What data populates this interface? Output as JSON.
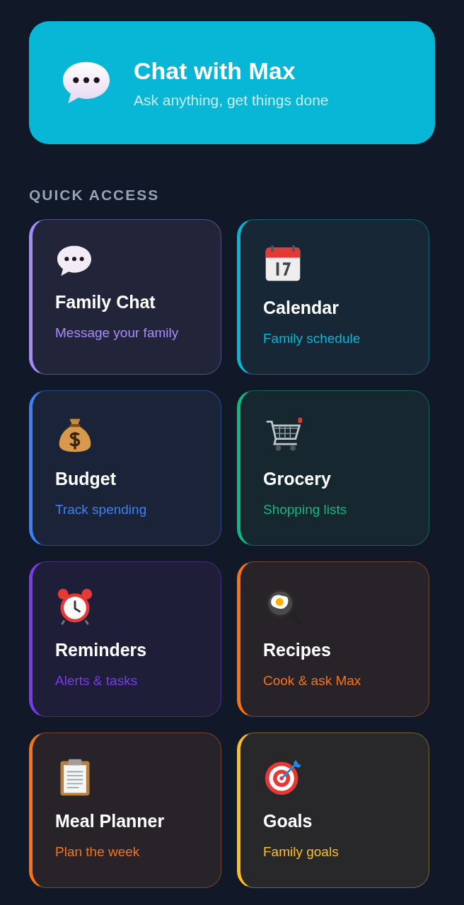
{
  "banner": {
    "title": "Chat with Max",
    "subtitle": "Ask anything, get things done"
  },
  "section_title": "QUICK ACCESS",
  "cards": [
    {
      "title": "Family Chat",
      "subtitle": "Message your family",
      "color": "#a78bfa"
    },
    {
      "title": "Calendar",
      "subtitle": "Family schedule",
      "color": "#06b6d4"
    },
    {
      "title": "Budget",
      "subtitle": "Track spending",
      "color": "#3b82f6"
    },
    {
      "title": "Grocery",
      "subtitle": "Shopping lists",
      "color": "#10b981"
    },
    {
      "title": "Reminders",
      "subtitle": "Alerts & tasks",
      "color": "#7c3aed"
    },
    {
      "title": "Recipes",
      "subtitle": "Cook & ask Max",
      "color": "#f97316"
    },
    {
      "title": "Meal Planner",
      "subtitle": "Plan the week",
      "color": "#f97316"
    },
    {
      "title": "Goals",
      "subtitle": "Family goals",
      "color": "#fbbf24"
    }
  ]
}
